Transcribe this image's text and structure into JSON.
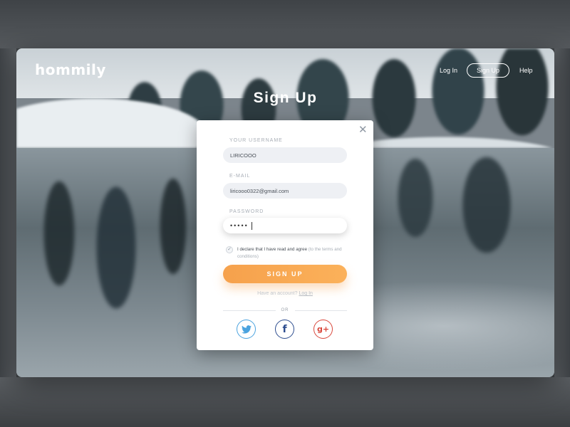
{
  "nav": {
    "logo": "hommily",
    "login_label": "Log In",
    "signup_label": "Sign Up",
    "help_label": "Help"
  },
  "page": {
    "title": "Sign Up"
  },
  "form": {
    "username": {
      "label": "YOUR USERNAME",
      "value": "LIRICOOO"
    },
    "email": {
      "label": "E-MAIL",
      "value": "liricooo0322@gmail.com"
    },
    "password": {
      "label": "PASSWORD",
      "masked_value": "•••••"
    },
    "terms": {
      "checked": true,
      "text_main": "I declare that I have read and agree",
      "text_muted": "(to the terms and conditions)"
    },
    "submit_label": "SIGN UP",
    "have_account_text": "Have an account?",
    "login_link": "Log In",
    "or_text": "OR"
  },
  "social": {
    "twitter_icon": "twitter-icon",
    "facebook_icon": "facebook-icon",
    "googleplus_icon": "google-plus-icon"
  },
  "colors": {
    "accent": "#f6a14c",
    "twitter": "#4aa3df",
    "facebook": "#2d4d8f",
    "google": "#d9473b"
  }
}
